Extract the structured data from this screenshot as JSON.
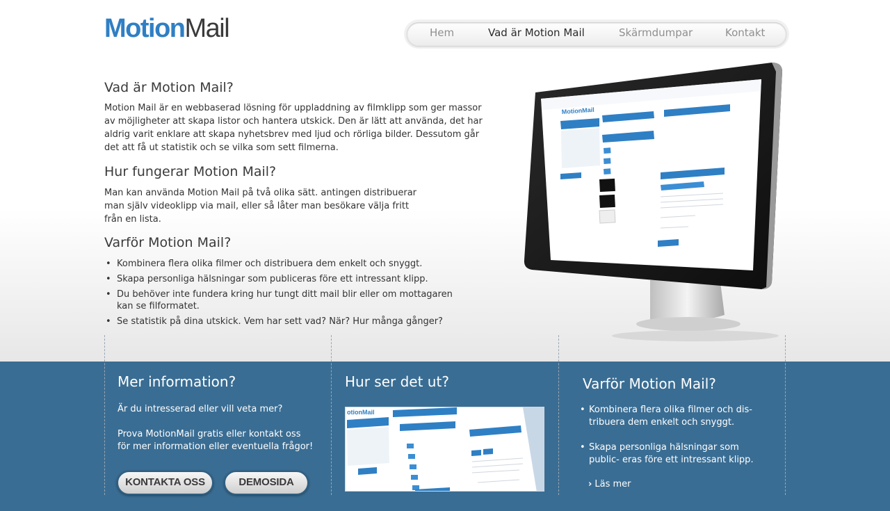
{
  "header": {
    "logo_part1": "Motion",
    "logo_part2": "Mail",
    "nav": [
      "Hem",
      "Vad är Motion Mail",
      "Skärmdumpar",
      "Kontakt"
    ]
  },
  "main": {
    "section1_title": "Vad är Motion Mail?",
    "section1_lines": [
      "Motion Mail är en webbaserad lösning för uppladdning av filmklipp som ger massor",
      "av möjligheter att skapa listor och hantera utskick. Den är lätt att använda, det har",
      "aldrig varit enklare att skapa nyhetsbrev med ljud och rörliga bilder. Dessutom går",
      "det att få ut statistik och se vilka som sett filmerna."
    ],
    "section2_title": "Hur fungerar Motion Mail?",
    "section2_lines": [
      "Man kan använda Motion Mail på två olika sätt. antingen distribuerar",
      "man själv videoklipp via mail, eller så låter man besökare välja fritt",
      "från en lista."
    ],
    "section3_title": "Varför Motion Mail?",
    "bullets": [
      "Kombinera flera olika filmer och distribuera dem enkelt och snyggt.",
      "Skapa personliga hälsningar som publiceras före ett intressant klipp.",
      "Du behöver inte fundera kring hur tungt ditt mail blir eller om mottagaren kan se filformatet.",
      "Se statistik på dina utskick. Vem har sett vad? När? Hur många gånger?"
    ]
  },
  "footer": {
    "col1_title": "Mer information?",
    "col1_text1": "Är du intresserad eller vill veta mer?",
    "col1_text2_line1": "Prova MotionMail gratis eller kontakt oss",
    "col1_text2_line2": "för mer information eller eventuella frågor!",
    "btn_contact": "KONTAKTA OSS",
    "btn_demo": "DEMOSIDA",
    "col2_title": "Hur ser det ut?",
    "col3_title": "Varför Motion Mail?",
    "col3_bullets": [
      "Kombinera flera olika filmer och dis- tribuera dem enkelt och snyggt.",
      "Skapa personliga hälsningar som public- eras före ett intressant klipp."
    ],
    "read_more": "Läs mer"
  },
  "colors": {
    "brand_blue": "#2f7fc4",
    "footer_bg": "#3a6d93"
  }
}
